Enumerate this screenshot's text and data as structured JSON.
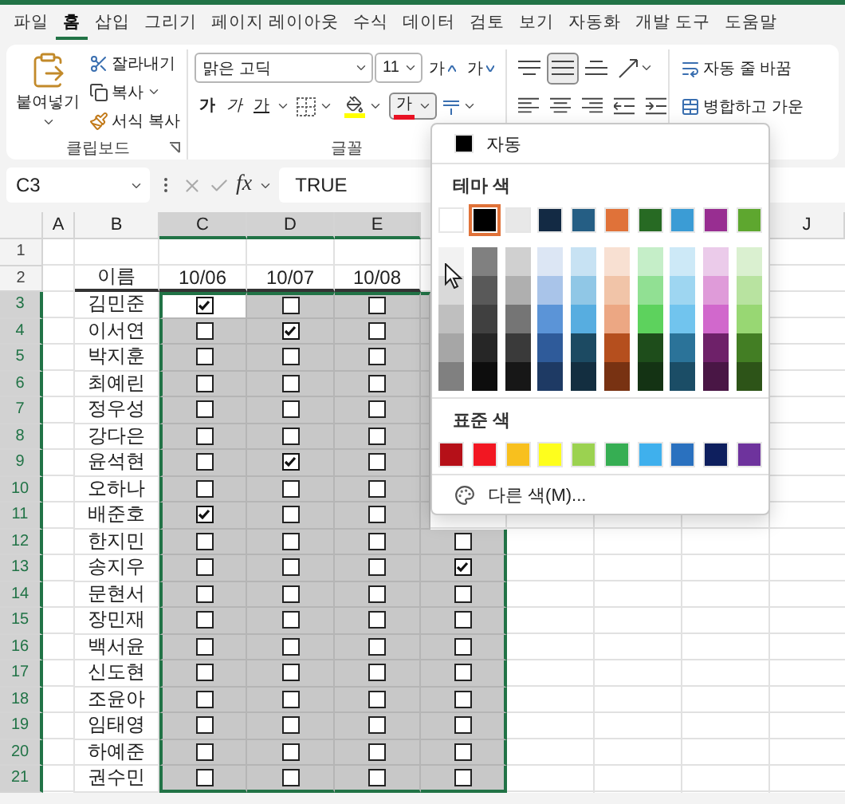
{
  "tabs": [
    {
      "label": "파일",
      "selected": false
    },
    {
      "label": "홈",
      "selected": true
    },
    {
      "label": "삽입",
      "selected": false
    },
    {
      "label": "그리기",
      "selected": false
    },
    {
      "label": "페이지 레이아웃",
      "selected": false
    },
    {
      "label": "수식",
      "selected": false
    },
    {
      "label": "데이터",
      "selected": false
    },
    {
      "label": "검토",
      "selected": false
    },
    {
      "label": "보기",
      "selected": false
    },
    {
      "label": "자동화",
      "selected": false
    },
    {
      "label": "개발 도구",
      "selected": false
    },
    {
      "label": "도움말",
      "selected": false
    }
  ],
  "clipboard": {
    "paste": "붙여넣기",
    "label": "클립보드",
    "items": [
      {
        "kind": "cut",
        "label": "잘라내기"
      },
      {
        "kind": "copy",
        "label": "복사"
      },
      {
        "kind": "format",
        "label": "서식 복사"
      }
    ]
  },
  "font": {
    "name": "맑은 고딕",
    "size": "11",
    "label": "글꼴",
    "grow": "가",
    "shrink": "가",
    "styles": [
      {
        "kind": "bold",
        "label": "가"
      },
      {
        "kind": "italic",
        "label": "가"
      },
      {
        "kind": "underline",
        "label": "가"
      }
    ],
    "font_color": {
      "label": "가",
      "expanded": true
    }
  },
  "alignment": {
    "buttons": [
      {
        "kind": "top",
        "selected": false
      },
      {
        "kind": "middle",
        "selected": true
      },
      {
        "kind": "bottom",
        "selected": false
      },
      {
        "kind": "orientation",
        "selected": false
      },
      {
        "kind": "left",
        "selected": false
      },
      {
        "kind": "center",
        "selected": false
      },
      {
        "kind": "right",
        "selected": false
      },
      {
        "kind": "outdent",
        "selected": false
      },
      {
        "kind": "indent",
        "selected": false
      }
    ]
  },
  "wrap": {
    "wrap_text": "자동 줄 바꿈",
    "merge": "병합하고 가운"
  },
  "formula_bar": {
    "name_box": "C3",
    "function_label": "fx",
    "formula": "TRUE"
  },
  "sheet": {
    "columns": [
      {
        "label": "A",
        "selected": false
      },
      {
        "label": "B",
        "selected": false
      },
      {
        "label": "C",
        "selected": true
      },
      {
        "label": "D",
        "selected": true
      },
      {
        "label": "E",
        "selected": true
      },
      {
        "label": "J",
        "selected": false
      }
    ],
    "rows": [
      {
        "number": "1",
        "selected": false
      },
      {
        "number": "2",
        "selected": false,
        "name": "이름",
        "headers": [
          "10/06",
          "10/07",
          "10/08"
        ]
      },
      {
        "number": "3",
        "selected": true,
        "name": "김민준",
        "checks": [
          {
            "checked": true,
            "active": true
          },
          {
            "checked": false,
            "active": false
          },
          {
            "checked": false,
            "active": false
          }
        ]
      },
      {
        "number": "4",
        "selected": true,
        "name": "이서연",
        "checks": [
          {
            "checked": false,
            "active": false
          },
          {
            "checked": true,
            "active": false
          },
          {
            "checked": false,
            "active": false
          }
        ]
      },
      {
        "number": "5",
        "selected": true,
        "name": "박지훈",
        "checks": [
          {
            "checked": false,
            "active": false
          },
          {
            "checked": false,
            "active": false
          },
          {
            "checked": false,
            "active": false
          }
        ]
      },
      {
        "number": "6",
        "selected": true,
        "name": "최예린",
        "checks": [
          {
            "checked": false,
            "active": false
          },
          {
            "checked": false,
            "active": false
          },
          {
            "checked": false,
            "active": false
          }
        ]
      },
      {
        "number": "7",
        "selected": true,
        "name": "정우성",
        "checks": [
          {
            "checked": false,
            "active": false
          },
          {
            "checked": false,
            "active": false
          },
          {
            "checked": false,
            "active": false
          }
        ]
      },
      {
        "number": "8",
        "selected": true,
        "name": "강다은",
        "checks": [
          {
            "checked": false,
            "active": false
          },
          {
            "checked": false,
            "active": false
          },
          {
            "checked": false,
            "active": false
          }
        ]
      },
      {
        "number": "9",
        "selected": true,
        "name": "윤석현",
        "checks": [
          {
            "checked": false,
            "active": false
          },
          {
            "checked": true,
            "active": false
          },
          {
            "checked": false,
            "active": false
          }
        ]
      },
      {
        "number": "10",
        "selected": true,
        "name": "오하나",
        "checks": [
          {
            "checked": false,
            "active": false
          },
          {
            "checked": false,
            "active": false
          },
          {
            "checked": false,
            "active": false
          }
        ]
      },
      {
        "number": "11",
        "selected": true,
        "name": "배준호",
        "checks": [
          {
            "checked": true,
            "active": false
          },
          {
            "checked": false,
            "active": false
          },
          {
            "checked": false,
            "active": false
          }
        ]
      },
      {
        "number": "12",
        "selected": true,
        "name": "한지민",
        "checks": [
          {
            "checked": false,
            "active": false
          },
          {
            "checked": false,
            "active": false
          },
          {
            "checked": false,
            "active": false
          },
          {
            "checked": false,
            "active": false
          }
        ]
      },
      {
        "number": "13",
        "selected": true,
        "name": "송지우",
        "checks": [
          {
            "checked": false,
            "active": false
          },
          {
            "checked": false,
            "active": false
          },
          {
            "checked": false,
            "active": false
          },
          {
            "checked": true,
            "active": false
          }
        ]
      },
      {
        "number": "14",
        "selected": true,
        "name": "문현서",
        "checks": [
          {
            "checked": false,
            "active": false
          },
          {
            "checked": false,
            "active": false
          },
          {
            "checked": false,
            "active": false
          },
          {
            "checked": false,
            "active": false
          }
        ]
      },
      {
        "number": "15",
        "selected": true,
        "name": "장민재",
        "checks": [
          {
            "checked": false,
            "active": false
          },
          {
            "checked": false,
            "active": false
          },
          {
            "checked": false,
            "active": false
          },
          {
            "checked": false,
            "active": false
          }
        ]
      },
      {
        "number": "16",
        "selected": true,
        "name": "백서윤",
        "checks": [
          {
            "checked": false,
            "active": false
          },
          {
            "checked": false,
            "active": false
          },
          {
            "checked": false,
            "active": false
          },
          {
            "checked": false,
            "active": false
          }
        ]
      },
      {
        "number": "17",
        "selected": true,
        "name": "신도현",
        "checks": [
          {
            "checked": false,
            "active": false
          },
          {
            "checked": false,
            "active": false
          },
          {
            "checked": false,
            "active": false
          },
          {
            "checked": false,
            "active": false
          }
        ]
      },
      {
        "number": "18",
        "selected": true,
        "name": "조윤아",
        "checks": [
          {
            "checked": false,
            "active": false
          },
          {
            "checked": false,
            "active": false
          },
          {
            "checked": false,
            "active": false
          },
          {
            "checked": false,
            "active": false
          }
        ]
      },
      {
        "number": "19",
        "selected": true,
        "name": "임태영",
        "checks": [
          {
            "checked": false,
            "active": false
          },
          {
            "checked": false,
            "active": false
          },
          {
            "checked": false,
            "active": false
          },
          {
            "checked": false,
            "active": false
          }
        ]
      },
      {
        "number": "20",
        "selected": true,
        "name": "하예준",
        "checks": [
          {
            "checked": false,
            "active": false
          },
          {
            "checked": false,
            "active": false
          },
          {
            "checked": false,
            "active": false
          },
          {
            "checked": false,
            "active": false
          }
        ]
      },
      {
        "number": "21",
        "selected": true,
        "name": "권수민",
        "checks": [
          {
            "checked": false,
            "active": false
          },
          {
            "checked": false,
            "active": false
          },
          {
            "checked": false,
            "active": false
          },
          {
            "checked": false,
            "active": false
          }
        ]
      }
    ]
  },
  "color_menu": {
    "automatic": {
      "label": "자동",
      "color": "#000000"
    },
    "theme_title": "테마 색",
    "theme": [
      {
        "color": "#ffffff",
        "selected": false,
        "shades": [
          {
            "color": "#f2f2f2"
          },
          {
            "color": "#d9d9d9"
          },
          {
            "color": "#bfbfbf"
          },
          {
            "color": "#a6a6a6"
          },
          {
            "color": "#808080"
          }
        ]
      },
      {
        "color": "#000000",
        "selected": true,
        "shades": [
          {
            "color": "#808080"
          },
          {
            "color": "#595959"
          },
          {
            "color": "#404040"
          },
          {
            "color": "#262626"
          },
          {
            "color": "#0d0d0d"
          }
        ]
      },
      {
        "color": "#e8e8e8",
        "selected": false,
        "shades": [
          {
            "color": "#d0d0d0"
          },
          {
            "color": "#afafaf"
          },
          {
            "color": "#757575"
          },
          {
            "color": "#3a3a3a"
          },
          {
            "color": "#171717"
          }
        ]
      },
      {
        "color": "#132a44",
        "selected": false,
        "shades": [
          {
            "color": "#dce6f4"
          },
          {
            "color": "#a9c4e9"
          },
          {
            "color": "#5b94d7"
          },
          {
            "color": "#2f5b9a"
          },
          {
            "color": "#1e3a64"
          }
        ]
      },
      {
        "color": "#255e84",
        "selected": false,
        "shades": [
          {
            "color": "#c7e2f3"
          },
          {
            "color": "#90c7e6"
          },
          {
            "color": "#57ade0"
          },
          {
            "color": "#1c4a62"
          },
          {
            "color": "#132e40"
          }
        ]
      },
      {
        "color": "#e07239",
        "selected": false,
        "shades": [
          {
            "color": "#f8e0d2"
          },
          {
            "color": "#f1c4a8"
          },
          {
            "color": "#eca783"
          },
          {
            "color": "#b54f1e"
          },
          {
            "color": "#783212"
          }
        ]
      },
      {
        "color": "#276a23",
        "selected": false,
        "shades": [
          {
            "color": "#c5eec8"
          },
          {
            "color": "#91e093"
          },
          {
            "color": "#5dd25d"
          },
          {
            "color": "#1e4d1b"
          },
          {
            "color": "#143314"
          }
        ]
      },
      {
        "color": "#3b9cd5",
        "selected": false,
        "shades": [
          {
            "color": "#cde9f7"
          },
          {
            "color": "#9ed6f1"
          },
          {
            "color": "#71c4ee"
          },
          {
            "color": "#2b7399"
          },
          {
            "color": "#1b4d66"
          }
        ]
      },
      {
        "color": "#982e91",
        "selected": false,
        "shades": [
          {
            "color": "#ebcbea"
          },
          {
            "color": "#df9bd9"
          },
          {
            "color": "#d168cc"
          },
          {
            "color": "#6e2169"
          },
          {
            "color": "#491645"
          }
        ]
      },
      {
        "color": "#5ea72f",
        "selected": false,
        "shades": [
          {
            "color": "#daf0d0"
          },
          {
            "color": "#b8e3a0"
          },
          {
            "color": "#98d773"
          },
          {
            "color": "#437e24"
          },
          {
            "color": "#2d5418"
          }
        ]
      }
    ],
    "standard_title": "표준 색",
    "standard": [
      {
        "color": "#b51018"
      },
      {
        "color": "#f21722"
      },
      {
        "color": "#f8c01e"
      },
      {
        "color": "#fefe1d"
      },
      {
        "color": "#9bd250"
      },
      {
        "color": "#36ae53"
      },
      {
        "color": "#3fb0ed"
      },
      {
        "color": "#2a71bf"
      },
      {
        "color": "#0e1f5e"
      },
      {
        "color": "#6e339d"
      }
    ],
    "more": "다른 색(M)..."
  }
}
